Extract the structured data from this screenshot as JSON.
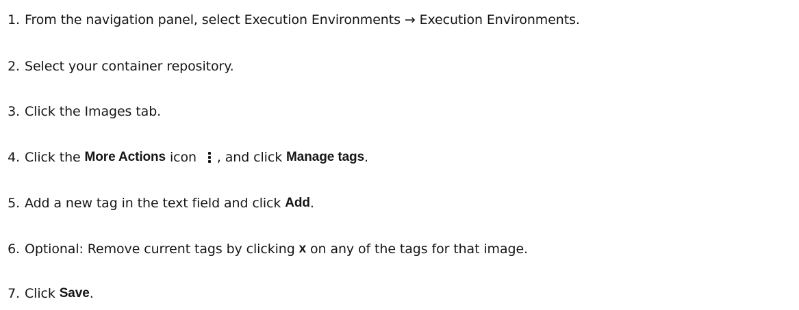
{
  "steps": [
    {
      "num": "1.",
      "t1": "From the navigation panel, select ",
      "b1": "Execution Environments",
      "arrow": " → ",
      "b2": "Execution Environments",
      "t2": "."
    },
    {
      "num": "2.",
      "t1": "Select your container repository."
    },
    {
      "num": "3.",
      "t1": "Click the ",
      "b1": "Images",
      "t2": " tab."
    },
    {
      "num": "4.",
      "t1": "Click the ",
      "b1": "More Actions",
      "t2": " icon ",
      "t3": ", and click ",
      "b2": "Manage tags",
      "t4": "."
    },
    {
      "num": "5.",
      "t1": "Add a new tag in the text field and click ",
      "b1": "Add",
      "t2": "."
    },
    {
      "num": "6.",
      "t1": "Optional: Remove ",
      "b1": "current tags",
      "t2": " by clicking ",
      "b2": "x",
      "t3": " on any of the tags for that image."
    },
    {
      "num": "7.",
      "t1": "Click ",
      "b1": "Save",
      "t2": "."
    }
  ],
  "icons": {
    "more_actions": "kebab-vertical-icon"
  }
}
